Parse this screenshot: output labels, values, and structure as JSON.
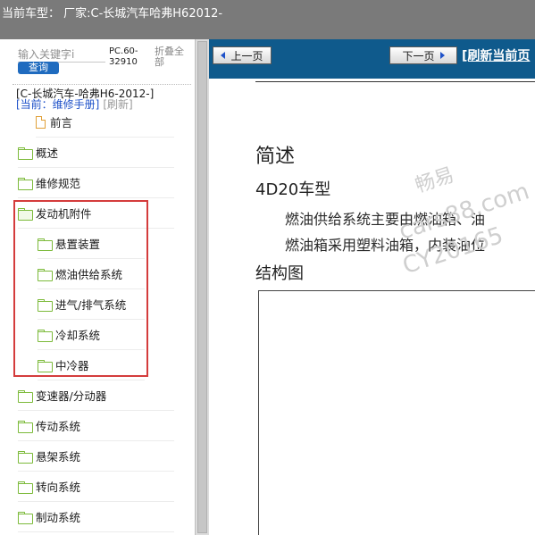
{
  "window": {
    "title": "当前车型：  厂家:C-长城汽车哈弗H62012-"
  },
  "sidebar": {
    "search_placeholder": "输入关键字i",
    "search_button": "查询",
    "model_code": "PC.60-32910",
    "collapse_all": "折叠全部",
    "book_path": "[C-长城汽车-哈弗H6-2012-]",
    "current_label": "[当前：维修手册]",
    "refresh_label": "[刷新]",
    "items": [
      {
        "label": "前言",
        "icon": "document-icon"
      },
      {
        "label": "概述",
        "icon": "folder-icon"
      },
      {
        "label": "维修规范",
        "icon": "folder-icon"
      },
      {
        "label": "发动机附件",
        "icon": "folder-open-icon"
      },
      {
        "label": "悬置装置",
        "icon": "folder-icon"
      },
      {
        "label": "燃油供给系统",
        "icon": "folder-icon"
      },
      {
        "label": "进气/排气系统",
        "icon": "folder-icon"
      },
      {
        "label": "冷却系统",
        "icon": "folder-icon"
      },
      {
        "label": "中冷器",
        "icon": "folder-icon"
      },
      {
        "label": "变速器/分动器",
        "icon": "folder-icon"
      },
      {
        "label": "传动系统",
        "icon": "folder-icon"
      },
      {
        "label": "悬架系统",
        "icon": "folder-icon"
      },
      {
        "label": "转向系统",
        "icon": "folder-icon"
      },
      {
        "label": "制动系统",
        "icon": "folder-icon"
      }
    ],
    "highlight_color": "#d43c3c"
  },
  "viewer": {
    "prev_page": "上一页",
    "next_page": "下一页",
    "refresh_page": "[刷新当前页",
    "heading": "简述",
    "subheading": "4D20车型",
    "paragraph_1": "燃油供给系统主要由燃油箱、油",
    "paragraph_2": "燃油箱采用塑料油箱，内装油位",
    "structure_heading": "结构图",
    "watermark_1": "畅易",
    "watermark_2": "cars88.com",
    "watermark_3": "CY20165",
    "navbar_color": "#0f5a8c"
  }
}
